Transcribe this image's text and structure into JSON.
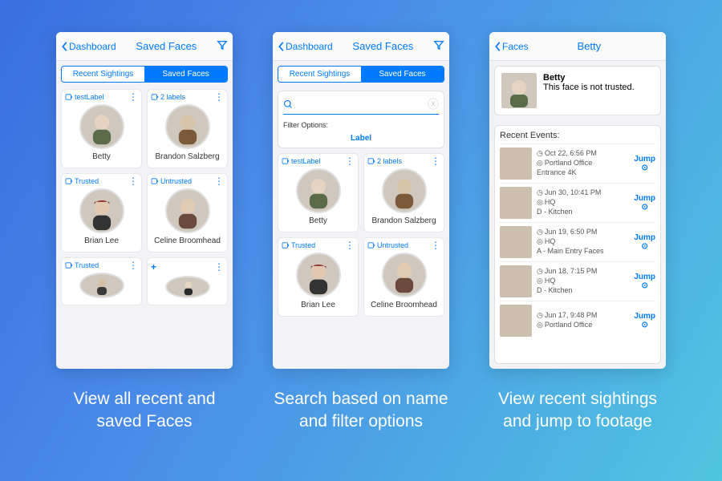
{
  "colors": {
    "accent": "#007aff"
  },
  "phone1": {
    "back": "Dashboard",
    "title": "Saved Faces",
    "tabs": {
      "recent": "Recent Sightings",
      "saved": "Saved Faces"
    },
    "cards": [
      {
        "label": "testLabel",
        "name": "Betty"
      },
      {
        "label": "2 labels",
        "name": "Brandon Salzberg"
      },
      {
        "label": "Trusted",
        "name": "Brian Lee"
      },
      {
        "label": "Untrusted",
        "name": "Celine Broomhead"
      },
      {
        "label": "Trusted",
        "name": ""
      },
      {
        "label": "+",
        "name": ""
      }
    ]
  },
  "phone2": {
    "back": "Dashboard",
    "title": "Saved Faces",
    "tabs": {
      "recent": "Recent Sightings",
      "saved": "Saved Faces"
    },
    "search": {
      "placeholder": "",
      "value": ""
    },
    "filter_header": "Filter Options:",
    "filter_label": "Label",
    "cards": [
      {
        "label": "testLabel",
        "name": "Betty"
      },
      {
        "label": "2 labels",
        "name": "Brandon Salzberg"
      },
      {
        "label": "Trusted",
        "name": "Brian Lee"
      },
      {
        "label": "Untrusted",
        "name": "Celine Broomhead"
      }
    ]
  },
  "phone3": {
    "back": "Faces",
    "title": "Betty",
    "detail": {
      "name": "Betty",
      "status": "This face is not trusted."
    },
    "events_header": "Recent Events:",
    "jump_label": "Jump",
    "events": [
      {
        "time": "Oct 22, 6:56 PM",
        "loc1": "Portland Office",
        "loc2": "Entrance 4K"
      },
      {
        "time": "Jun 30, 10:41 PM",
        "loc1": "HQ",
        "loc2": "D - Kitchen"
      },
      {
        "time": "Jun 19, 6:50 PM",
        "loc1": "HQ",
        "loc2": "A - Main Entry Faces"
      },
      {
        "time": "Jun 18, 7:15 PM",
        "loc1": "HQ",
        "loc2": "D - Kitchen"
      },
      {
        "time": "Jun 17, 9:48 PM",
        "loc1": "Portland Office",
        "loc2": ""
      }
    ]
  },
  "captions": {
    "c1": "View all recent and saved Faces",
    "c2": "Search based on name and filter options",
    "c3": "View recent sightings and jump to footage"
  }
}
